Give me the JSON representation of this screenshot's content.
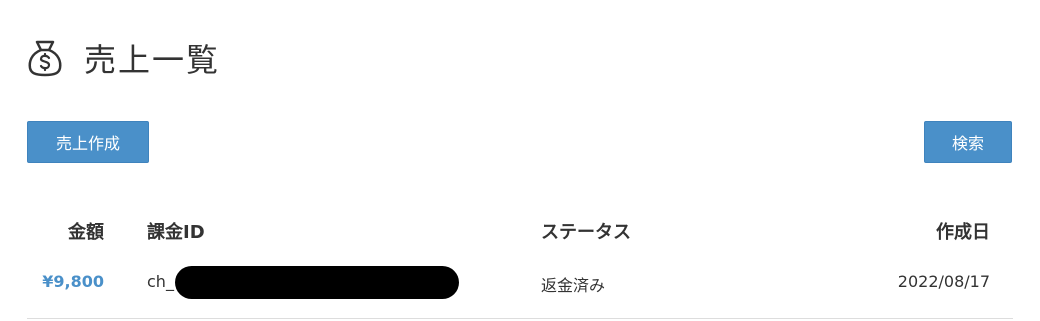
{
  "header": {
    "icon": "money-bag-icon",
    "title": "売上一覧"
  },
  "toolbar": {
    "create_label": "売上作成",
    "search_label": "検索"
  },
  "table": {
    "columns": {
      "amount": "金額",
      "charge_id": "課金ID",
      "status": "ステータス",
      "created": "作成日"
    },
    "rows": [
      {
        "amount": "¥9,800",
        "charge_id": "ch_",
        "status": "返金済み",
        "created": "2022/08/17"
      }
    ]
  },
  "colors": {
    "accent": "#4a90c9",
    "text": "#333333",
    "divider": "#dddddd"
  }
}
